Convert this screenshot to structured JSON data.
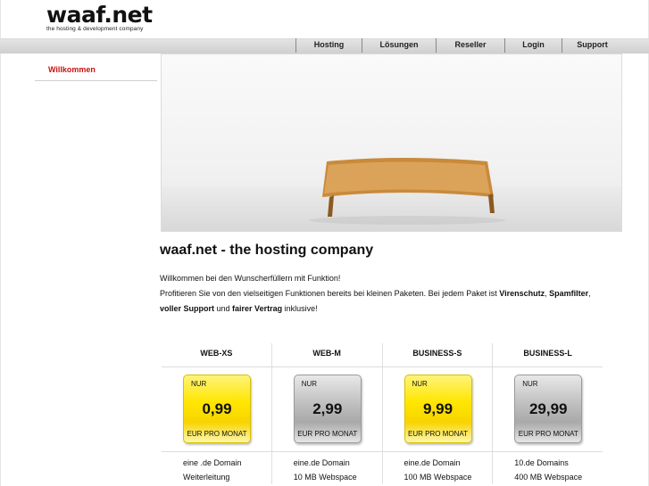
{
  "logo": {
    "name": "waaf.net",
    "tagline": "the hosting & development company"
  },
  "nav": [
    {
      "label": "Hosting"
    },
    {
      "label": "Lösungen"
    },
    {
      "label": "Reseller"
    },
    {
      "label": "Login"
    },
    {
      "label": "Support"
    }
  ],
  "sidebar": {
    "items": [
      {
        "label": "Willkommen"
      }
    ]
  },
  "main": {
    "headline": "waaf.net - the hosting company",
    "intro_line1": "Willkommen bei den Wunscherfüllern mit Funktion!",
    "intro_line2_a": "Profitieren Sie von den vielseitigen Funktionen bereits bei kleinen Paketen. Bei jedem Paket ist ",
    "intro_bold1": "Virenschutz",
    "intro_sep1": ", ",
    "intro_bold2": "Spamfilter",
    "intro_sep2": ", ",
    "intro_bold3": "voller Support",
    "intro_and": " und ",
    "intro_bold4": "fairer Vertrag",
    "intro_end": " inklusive!"
  },
  "packages": [
    {
      "name": "WEB-XS",
      "prefix": "NUR",
      "price": "0,99",
      "unit": "EUR PRO MONAT",
      "color": "yellow",
      "features": [
        "eine .de Domain",
        "Weiterleitung"
      ]
    },
    {
      "name": "WEB-M",
      "prefix": "NUR",
      "price": "2,99",
      "unit": "EUR PRO MONAT",
      "color": "grey",
      "features": [
        "eine.de Domain",
        "10 MB Webspace"
      ]
    },
    {
      "name": "BUSINESS-S",
      "prefix": "NUR",
      "price": "9,99",
      "unit": "EUR PRO MONAT",
      "color": "yellow",
      "features": [
        "eine.de Domain",
        "100 MB Webspace"
      ]
    },
    {
      "name": "BUSINESS-L",
      "prefix": "NUR",
      "price": "29,99",
      "unit": "EUR PRO MONAT",
      "color": "grey",
      "features": [
        "10.de Domains",
        "400 MB Webspace"
      ]
    }
  ],
  "colors": {
    "accent": "#cc1010",
    "badge_yellow": "#ffe600",
    "badge_grey": "#b5b5b5",
    "navbar": "#d8d8d8"
  }
}
